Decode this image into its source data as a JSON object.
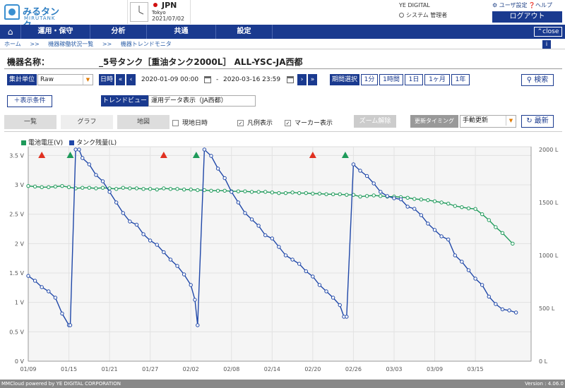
{
  "header": {
    "logo_text": "みるタンク",
    "logo_sub": "MIRUTANK",
    "country": "JPN",
    "city": "Tokyo",
    "date": "2021/07/02",
    "company": "YE DIGITAL",
    "user": "システム 管理者",
    "user_settings": "ユーザ設定",
    "help": "ヘルプ",
    "logout": "ログアウト"
  },
  "nav": {
    "items": [
      "運用・保守",
      "分析",
      "共通",
      "設定"
    ],
    "close": "close"
  },
  "breadcrumb": [
    "ホーム",
    ">>",
    "機器稼働状況一覧",
    ">>",
    "機器トレンドモニタ"
  ],
  "device": {
    "label": "機器名称：",
    "name": "_5号タンク［重油タンク2000L］ ALL-YSC-JA西都"
  },
  "filters": {
    "aggregation_label": "集計単位",
    "aggregation_value": "Raw",
    "datetime_label": "日時",
    "start": "2020-01-09 00:00",
    "dash": "-",
    "end": "2020-03-16 23:59",
    "period_label": "期間選択",
    "period_buttons": [
      "1分",
      "1時間",
      "1日",
      "1ヶ月",
      "1年"
    ],
    "search": "検索",
    "add_condition": "表示条件",
    "trend_view_label": "トレンドビュー",
    "trend_view_value": "運用データ表示（JA西都）"
  },
  "tabs": [
    "一覧",
    "グラフ",
    "地図"
  ],
  "options": {
    "current_time": "現地日時",
    "legend_show": "凡例表示",
    "marker_show": "マーカー表示",
    "zoom_reset": "ズーム解除",
    "update_timing_label": "更新タイミング",
    "update_timing_value": "手動更新",
    "refresh": "最新"
  },
  "chart_data": {
    "type": "line",
    "x_tick_labels": [
      "01/09",
      "01/15",
      "01/21",
      "01/27",
      "02/02",
      "02/08",
      "02/14",
      "02/20",
      "02/26",
      "03/03",
      "03/09",
      "03/15"
    ],
    "y_left_ticks": [
      "0 V",
      "0.5 V",
      "1 V",
      "1.5 V",
      "2 V",
      "2.5 V",
      "3 V",
      "3.5 V"
    ],
    "y_right_ticks": [
      "0 L",
      "500 L",
      "1000 L",
      "1500 L",
      "2000 L"
    ],
    "ylim_left": [
      0,
      3.6
    ],
    "ylim_right": [
      0,
      2000
    ],
    "xlim_days": [
      0,
      72
    ],
    "grid": true,
    "legend_position": "top-left",
    "series": [
      {
        "name": "電池電圧(V)",
        "axis": "left",
        "color": "#1e9a5a",
        "x": [
          0,
          1,
          2,
          3,
          4,
          5,
          6,
          7,
          8,
          9,
          10,
          11,
          12,
          13,
          14,
          15,
          16,
          17,
          18,
          19,
          20,
          21,
          22,
          23,
          24,
          25,
          26,
          27,
          28,
          29,
          30,
          31,
          32,
          33,
          34,
          35,
          36,
          37,
          38,
          39,
          40,
          41,
          42,
          43,
          44,
          45,
          46,
          47,
          48,
          49,
          50,
          51,
          52,
          53,
          54,
          55,
          56,
          57,
          58,
          59,
          60,
          61,
          62,
          63,
          64,
          65,
          66,
          67,
          68,
          69,
          70,
          71.5
        ],
        "values": [
          2.98,
          2.97,
          2.96,
          2.96,
          2.97,
          2.98,
          2.96,
          2.94,
          2.95,
          2.95,
          2.94,
          2.95,
          2.94,
          2.93,
          2.95,
          2.94,
          2.94,
          2.93,
          2.93,
          2.92,
          2.94,
          2.93,
          2.93,
          2.92,
          2.92,
          2.91,
          2.91,
          2.9,
          2.9,
          2.9,
          2.89,
          2.89,
          2.89,
          2.88,
          2.88,
          2.88,
          2.87,
          2.86,
          2.86,
          2.87,
          2.86,
          2.86,
          2.85,
          2.85,
          2.84,
          2.84,
          2.84,
          2.83,
          2.83,
          2.8,
          2.81,
          2.82,
          2.81,
          2.8,
          2.8,
          2.79,
          2.78,
          2.76,
          2.75,
          2.74,
          2.72,
          2.7,
          2.68,
          2.64,
          2.62,
          2.6,
          2.59,
          2.5,
          2.4,
          2.28,
          2.18,
          2.0
        ]
      },
      {
        "name": "タンク残量(L)",
        "axis": "right",
        "color": "#1f47a8",
        "x": [
          0,
          1,
          2,
          3,
          4,
          5,
          6,
          6.2,
          7,
          7.5,
          8,
          9,
          10,
          11,
          12,
          13,
          14,
          15,
          16,
          17,
          18,
          19,
          20,
          21,
          22,
          23,
          24,
          24.6,
          25,
          26,
          27,
          28,
          29,
          30,
          31,
          32,
          33,
          34,
          35,
          36,
          37,
          38,
          39,
          40,
          41,
          42,
          43,
          44,
          45,
          46,
          46.6,
          47,
          48,
          49,
          50,
          51,
          52,
          53,
          54,
          55,
          56,
          57,
          58,
          59,
          60,
          61,
          62,
          63,
          64,
          65,
          66,
          67,
          68,
          69,
          70,
          71,
          72
        ],
        "values": [
          806,
          760,
          700,
          660,
          600,
          450,
          340,
          340,
          2000,
          2000,
          1920,
          1860,
          1760,
          1700,
          1600,
          1500,
          1400,
          1320,
          1290,
          1200,
          1140,
          1100,
          1030,
          960,
          900,
          820,
          720,
          580,
          340,
          2000,
          1940,
          1820,
          1730,
          1600,
          1500,
          1400,
          1340,
          1280,
          1190,
          1160,
          1080,
          1000,
          960,
          920,
          850,
          800,
          720,
          660,
          600,
          530,
          420,
          420,
          1860,
          1800,
          1750,
          1680,
          1600,
          1560,
          1540,
          1530,
          1460,
          1440,
          1380,
          1300,
          1240,
          1180,
          1150,
          1000,
          940,
          860,
          780,
          720,
          610,
          540,
          490,
          480,
          460
        ]
      }
    ],
    "markers": [
      {
        "type": "alert",
        "x": 2,
        "color": "#e03020"
      },
      {
        "type": "refill",
        "x": 6.2,
        "color": "#1e9a5a"
      },
      {
        "type": "alert",
        "x": 20,
        "color": "#e03020"
      },
      {
        "type": "refill",
        "x": 24.8,
        "color": "#1e9a5a"
      },
      {
        "type": "alert",
        "x": 42,
        "color": "#e03020"
      },
      {
        "type": "refill",
        "x": 46.8,
        "color": "#1e9a5a"
      }
    ]
  },
  "footer": {
    "left": "MMCloud powered by YE DIGITAL CORPORATION",
    "right": "Version : 4.06.0"
  }
}
